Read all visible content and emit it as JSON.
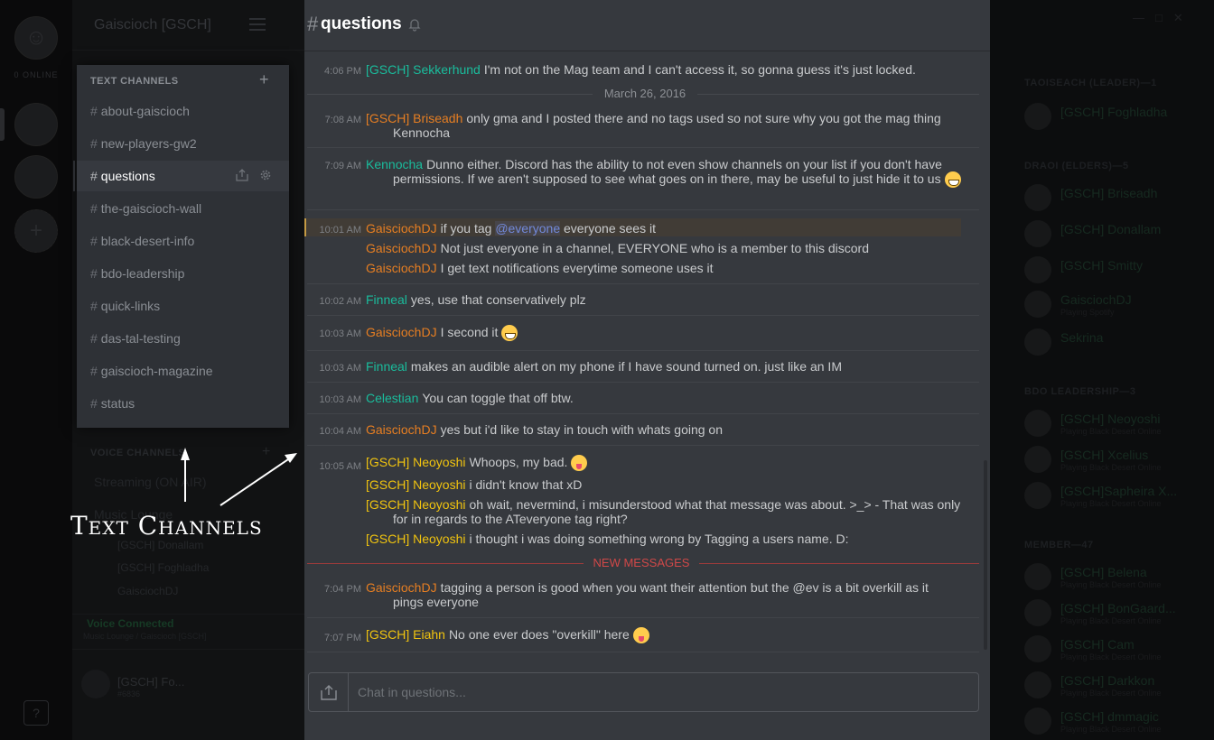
{
  "servers": {
    "online_label": "0 ONLINE",
    "help_label": "?"
  },
  "guild": {
    "name": "Gaiscioch [GSCH]"
  },
  "text_channels": {
    "header": "TEXT CHANNELS",
    "add_label": "+",
    "items": [
      {
        "name": "about-gaiscioch"
      },
      {
        "name": "new-players-gw2"
      },
      {
        "name": "questions"
      },
      {
        "name": "the-gaiscioch-wall"
      },
      {
        "name": "black-desert-info"
      },
      {
        "name": "bdo-leadership"
      },
      {
        "name": "quick-links"
      },
      {
        "name": "das-tal-testing"
      },
      {
        "name": "gaiscioch-magazine"
      },
      {
        "name": "status"
      }
    ],
    "hash": "#"
  },
  "voice": {
    "header": "VOICE CHANNELS",
    "add_label": "+",
    "channel1": "Streaming (ON AIR)",
    "channel2": "Music Lounge",
    "users": [
      "[GSCH] Donallam",
      "[GSCH] Foghladha",
      "GaisciochDJ"
    ],
    "connected": "Voice Connected",
    "location": "Music Lounge / Gaiscioch [GSCH]"
  },
  "self_user": {
    "name": "[GSCH] Fo...",
    "tag": "#6836"
  },
  "annotation": {
    "label": "Text Channels"
  },
  "chat": {
    "hash": "#",
    "channel": "questions",
    "input_placeholder": "Chat in questions...",
    "date_divider": "March 26, 2016",
    "new_messages": "NEW MESSAGES",
    "colors": {
      "teal": "#1abc9c",
      "orange": "#e67e22",
      "yellow": "#f1c40f",
      "mention": "#7289da"
    },
    "messages": {
      "m1": {
        "time": "4:06 PM",
        "author": "[GSCH] Sekkerhund",
        "text": "I'm not on the Mag team and I can't access it, so gonna guess it's just locked."
      },
      "m2": {
        "time": "7:08 AM",
        "author": "[GSCH] Briseadh",
        "text": "only gma and I posted there and no tags used so not sure why you got the mag thing Kennocha"
      },
      "m3": {
        "time": "7:09 AM",
        "author": "Kennocha",
        "text": "Dunno either. Discord has the ability to not even show channels on your list if you don't have permissions. If we aren't supposed to see what goes on in there, may be useful to just hide it to us"
      },
      "m4": {
        "time": "10:01 AM",
        "author": "GaisciochDJ",
        "text_pre": "if you tag",
        "mention": "@everyone",
        "text_post": "everyone sees it"
      },
      "m4b": {
        "author": "GaisciochDJ",
        "text": "Not just everyone in a channel, EVERYONE who is a member to this discord"
      },
      "m4c": {
        "author": "GaisciochDJ",
        "text": "I get text notifications everytime someone uses it"
      },
      "m5": {
        "time": "10:02 AM",
        "author": "Finneal",
        "text": "yes, use that conservatively plz"
      },
      "m6": {
        "time": "10:03 AM",
        "author": "GaisciochDJ",
        "text": "I second it"
      },
      "m7": {
        "time": "10:03 AM",
        "author": "Finneal",
        "text": "makes an audible alert on my phone if I have sound turned on.  just like an IM"
      },
      "m8": {
        "time": "10:03 AM",
        "author": "Celestian",
        "text": "You can toggle that off btw."
      },
      "m9": {
        "time": "10:04 AM",
        "author": "GaisciochDJ",
        "text": "yes but i'd like to stay in touch with whats going on"
      },
      "m10": {
        "time": "10:05 AM",
        "author": "[GSCH] Neoyoshi",
        "text": "Whoops, my bad."
      },
      "m10b": {
        "author": "[GSCH] Neoyoshi",
        "text": "i didn't know that xD"
      },
      "m10c": {
        "author": "[GSCH] Neoyoshi",
        "text": "oh wait, nevermind, i misunderstood what that message was about. >_>  - That was only for in regards to the ATeveryone tag right?"
      },
      "m10d": {
        "author": "[GSCH] Neoyoshi",
        "text": "i thought i was doing something wrong by Tagging a users name.  D:"
      },
      "m11": {
        "time": "7:04 PM",
        "author": "GaisciochDJ",
        "text": "tagging a person is good when you want their attention but the @ev is a bit overkill as it pings everyone"
      },
      "m12": {
        "time": "7:07 PM",
        "author": "[GSCH] Eiahn",
        "text": "No one ever does \"overkill\" here"
      }
    }
  },
  "members": {
    "groups": {
      "g1": "TAOISEACH (LEADER)—1",
      "g2": "DRAOI (ELDERS)—5",
      "g3": "BDO LEADERSHIP—3",
      "g4": "MEMBER—47"
    },
    "list": [
      {
        "name": "[GSCH] Foghladha",
        "status": ""
      },
      {
        "name": "[GSCH] Briseadh",
        "status": ""
      },
      {
        "name": "[GSCH] Donallam",
        "status": ""
      },
      {
        "name": "[GSCH] Smitty",
        "status": ""
      },
      {
        "name": "GaisciochDJ",
        "status": "Playing Spotify"
      },
      {
        "name": "Sekrina",
        "status": ""
      },
      {
        "name": "[GSCH] Neoyoshi",
        "status": "Playing Black Desert Online"
      },
      {
        "name": "[GSCH] Xcelius",
        "status": "Playing Black Desert Online"
      },
      {
        "name": "[GSCH]Sapheira X...",
        "status": "Playing Black Desert Online"
      },
      {
        "name": "[GSCH] Belena",
        "status": "Playing Black Desert Online"
      },
      {
        "name": "[GSCH] BonGaard...",
        "status": "Playing Black Desert Online"
      },
      {
        "name": "[GSCH] Cam",
        "status": "Playing Black Desert Online"
      },
      {
        "name": "[GSCH] Darkkon",
        "status": "Playing Black Desert Online"
      },
      {
        "name": "[GSCH] dmmagic",
        "status": "Playing Black Desert Online"
      }
    ]
  }
}
